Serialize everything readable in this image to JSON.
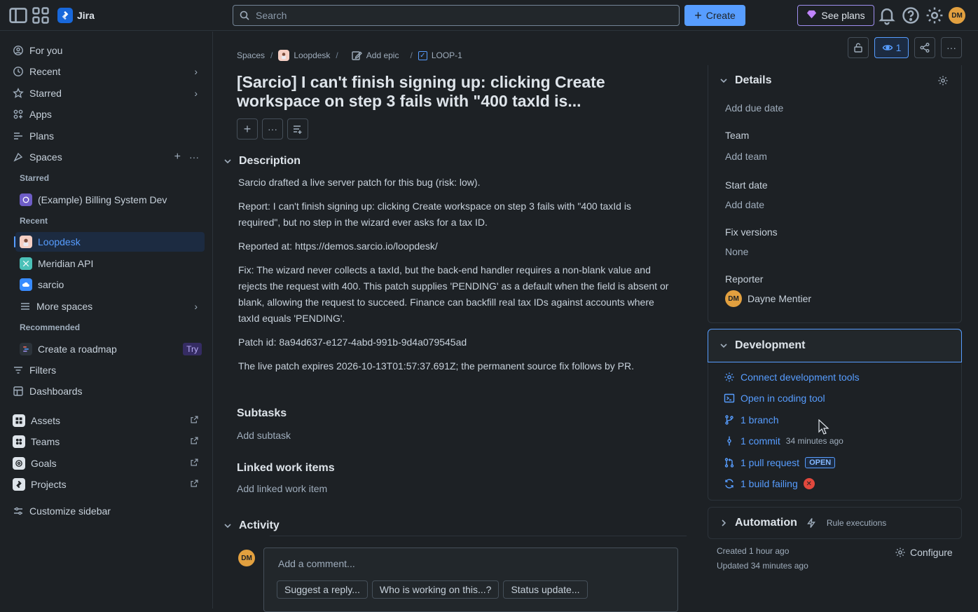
{
  "app": {
    "name": "Jira"
  },
  "search": {
    "placeholder": "Search"
  },
  "topbar": {
    "create_label": "Create",
    "see_plans_label": "See plans",
    "user_initials": "DM"
  },
  "sidebar": {
    "nav_top": [
      {
        "label": "For you",
        "icon": "person-circle-icon"
      },
      {
        "label": "Recent",
        "icon": "clock-icon"
      },
      {
        "label": "Starred",
        "icon": "star-icon"
      },
      {
        "label": "Apps",
        "icon": "apps-icon"
      },
      {
        "label": "Plans",
        "icon": "plans-icon"
      },
      {
        "label": "Spaces",
        "icon": "spaces-icon"
      }
    ],
    "starred_label": "Starred",
    "starred_spaces": [
      {
        "label": "(Example) Billing System Dev"
      }
    ],
    "recent_label": "Recent",
    "recent_spaces": [
      {
        "label": "Loopdesk"
      },
      {
        "label": "Meridian API"
      },
      {
        "label": "sarcio"
      }
    ],
    "more_spaces": "More spaces",
    "recommended_label": "Recommended",
    "recommended": {
      "label": "Create a roadmap",
      "badge": "Try"
    },
    "nav_bottom": [
      {
        "label": "Filters"
      },
      {
        "label": "Dashboards"
      }
    ],
    "nav_external": [
      {
        "label": "Assets"
      },
      {
        "label": "Teams"
      },
      {
        "label": "Goals"
      },
      {
        "label": "Projects"
      }
    ],
    "customize": "Customize sidebar"
  },
  "breadcrumb": {
    "spaces": "Spaces",
    "project": "Loopdesk",
    "epic": "Add epic",
    "issue": "LOOP-1"
  },
  "issue": {
    "title": "[Sarcio] I can't finish signing up: clicking Create workspace on step 3 fails with \"400 taxId is...",
    "description_heading": "Description",
    "description": [
      "Sarcio drafted a live server patch for this bug (risk: low).",
      "Report: I can't finish signing up: clicking Create workspace on step 3 fails with \"400 taxId is required\", but no step in the wizard ever asks for a tax ID.",
      "Reported at: https://demos.sarcio.io/loopdesk/",
      "Fix: The wizard never collects a taxId, but the back-end handler requires a non-blank value and rejects the request with 400. This patch supplies 'PENDING' as a default when the field is absent or blank, allowing the request to succeed. Finance can backfill real tax IDs against accounts where taxId equals 'PENDING'.",
      "Patch id: 8a94d637-e127-4abd-991b-9d4a079545ad",
      "The live patch expires 2026-10-13T01:57:37.691Z; the permanent source fix follows by PR."
    ],
    "subtasks_heading": "Subtasks",
    "add_subtask": "Add subtask",
    "linked_heading": "Linked work items",
    "add_linked": "Add linked work item",
    "activity_heading": "Activity",
    "comment_placeholder": "Add a comment...",
    "comment_chips": [
      "Suggest a reply...",
      "Who is working on this...?",
      "Status update..."
    ]
  },
  "right": {
    "watch_count": "1",
    "details_heading": "Details",
    "due_date": "Add due date",
    "team_label": "Team",
    "team_value": "Add team",
    "start_label": "Start date",
    "start_value": "Add date",
    "fix_label": "Fix versions",
    "fix_value": "None",
    "reporter_label": "Reporter",
    "reporter_initials": "DM",
    "reporter_name": "Dayne Mentier",
    "dev_heading": "Development",
    "dev_items": {
      "connect": "Connect development tools",
      "open_tool": "Open in coding tool",
      "branch": "1 branch",
      "commit": "1 commit",
      "commit_time": "34 minutes ago",
      "pr": "1 pull request",
      "pr_badge": "OPEN",
      "build": "1 build failing"
    },
    "automation_heading": "Automation",
    "rule_exec": "Rule executions",
    "created": "Created 1 hour ago",
    "updated": "Updated 34 minutes ago",
    "configure": "Configure"
  },
  "colors": {
    "accent": "#579dff",
    "background": "#1d2125",
    "brand": "#1868db",
    "danger": "#e2483d"
  }
}
